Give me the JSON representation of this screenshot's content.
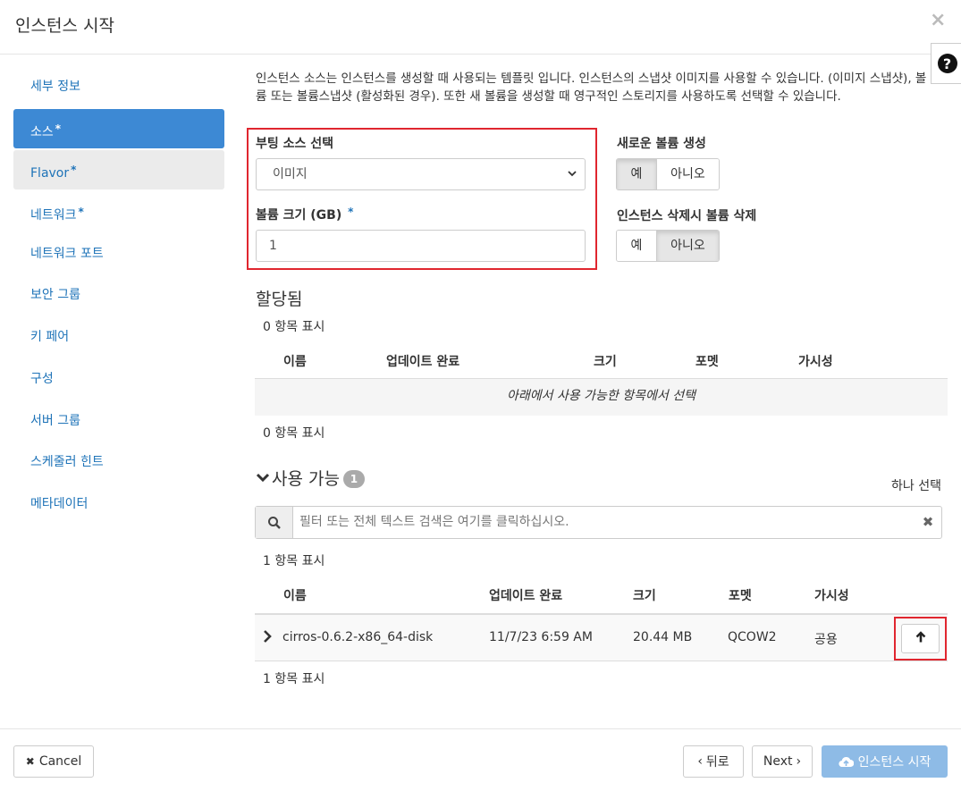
{
  "header": {
    "title": "인스턴스 시작",
    "close_icon": "×",
    "help_icon": "?"
  },
  "nav": [
    {
      "label": "세부 정보",
      "star": ""
    },
    {
      "label": "소스",
      "star": "*"
    },
    {
      "label": "Flavor",
      "star": "*"
    },
    {
      "label": "네트워크",
      "star": "*"
    },
    {
      "label": "네트워크 포트",
      "star": ""
    },
    {
      "label": "보안 그룹",
      "star": ""
    },
    {
      "label": "키 페어",
      "star": ""
    },
    {
      "label": "구성",
      "star": ""
    },
    {
      "label": "서버 그룹",
      "star": ""
    },
    {
      "label": "스케줄러 힌트",
      "star": ""
    },
    {
      "label": "메타데이터",
      "star": ""
    }
  ],
  "description": "인스턴스 소스는 인스턴스를 생성할 때 사용되는 템플릿 입니다. 인스턴스의 스냅샷 이미지를 사용할 수 있습니다. (이미지 스냅샷), 볼륨 또는 볼륨스냅샷 (활성화된 경우). 또한 새 볼륨을 생성할 때 영구적인 스토리지를 사용하도록 선택할 수 있습니다.",
  "boot_source": {
    "label": "부팅 소스 선택",
    "value": "이미지"
  },
  "volume_size": {
    "label": "볼륨 크기 (GB)",
    "star": "*",
    "value": "1"
  },
  "create_volume": {
    "label": "새로운 볼륨 생성",
    "yes": "예",
    "no": "아니오"
  },
  "delete_volume": {
    "label": "인스턴스 삭제시 볼륨 삭제",
    "yes": "예",
    "no": "아니오"
  },
  "allocated": {
    "title": "할당됨",
    "count_top": "0 항목 표시",
    "count_bottom": "0 항목 표시",
    "columns": [
      "이름",
      "업데이트 완료",
      "크기",
      "포멧",
      "가시성"
    ],
    "empty_text": "아래에서 사용 가능한 항목에서 선택"
  },
  "available": {
    "title": "사용 가능",
    "badge": "1",
    "select_hint": "하나 선택",
    "search_placeholder": "필터 또는 전체 텍스트 검색은 여기를 클릭하십시오.",
    "count_top": "1 항목 표시",
    "count_bottom": "1 항목 표시",
    "columns": [
      "이름",
      "업데이트 완료",
      "크기",
      "포멧",
      "가시성"
    ],
    "rows": [
      {
        "name": "cirros-0.6.2-x86_64-disk",
        "updated": "11/7/23 6:59 AM",
        "size": "20.44 MB",
        "format": "QCOW2",
        "visibility": "공용"
      }
    ]
  },
  "footer": {
    "cancel": "Cancel",
    "back": "뒤로",
    "next": "Next",
    "launch": "인스턴스 시작"
  },
  "colors": {
    "accent": "#3d89d4",
    "highlight": "#e0262f",
    "link": "#1e73b8"
  }
}
